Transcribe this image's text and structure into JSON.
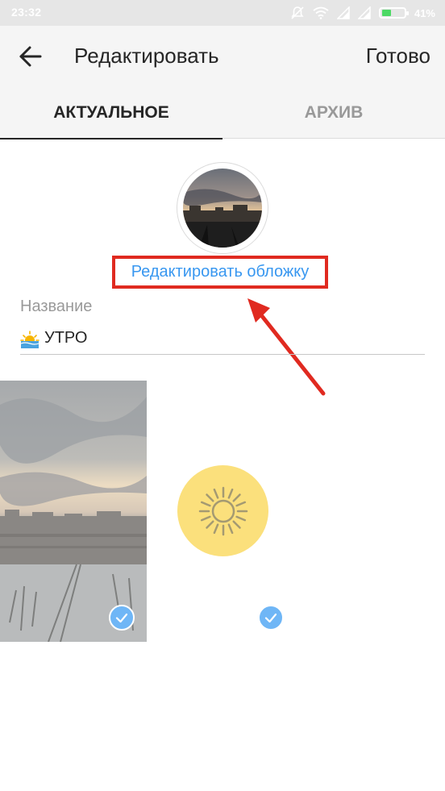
{
  "status_bar": {
    "time": "23:32",
    "battery_percent": "41%",
    "battery_level": 0.41,
    "icons": [
      "mute-icon",
      "wifi-icon",
      "signal-icon",
      "signal-icon",
      "battery-icon"
    ]
  },
  "header": {
    "back_icon": "arrow-left-icon",
    "title": "Редактировать",
    "done_label": "Готово"
  },
  "tabs": [
    {
      "label": "АКТУАЛЬНОЕ",
      "active": true
    },
    {
      "label": "АРХИВ",
      "active": false
    }
  ],
  "cover": {
    "edit_link": "Редактировать обложку"
  },
  "name_field": {
    "label": "Название",
    "emoji_icon": "sunrise-emoji-icon",
    "value": "УТРО"
  },
  "stories": [
    {
      "type": "photo",
      "selected": true
    },
    {
      "type": "sun-sticker",
      "icon": "sun-icon",
      "selected": true
    }
  ],
  "colors": {
    "accent_link": "#3897f0",
    "annotation_red": "#e02a20",
    "sun_yellow": "#fbe07c",
    "check_blue": "#6fb6f6",
    "battery_green": "#4cd964"
  }
}
